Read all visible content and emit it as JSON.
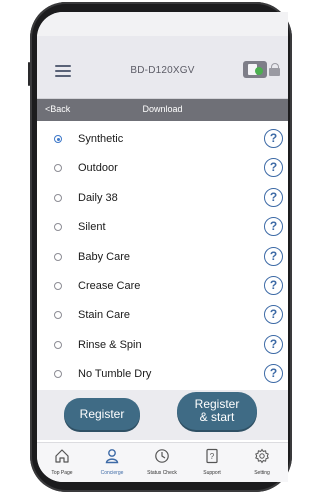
{
  "header": {
    "model": "BD-D120XGV"
  },
  "nav": {
    "back_label": "<Back",
    "title": "Download"
  },
  "programs": [
    {
      "label": "Synthetic",
      "selected": true
    },
    {
      "label": "Outdoor",
      "selected": false
    },
    {
      "label": "Daily 38",
      "selected": false
    },
    {
      "label": "Silent",
      "selected": false
    },
    {
      "label": "Baby Care",
      "selected": false
    },
    {
      "label": "Crease Care",
      "selected": false
    },
    {
      "label": "Stain Care",
      "selected": false
    },
    {
      "label": "Rinse & Spin",
      "selected": false
    },
    {
      "label": "No Tumble Dry",
      "selected": false
    }
  ],
  "help_glyph": "?",
  "actions": {
    "register": "Register",
    "register_start": "Register\n& start"
  },
  "tabs": [
    {
      "label": "Top Page",
      "icon": "home-icon",
      "active": false
    },
    {
      "label": "Concierge",
      "icon": "person-icon",
      "active": true
    },
    {
      "label": "Status Check",
      "icon": "status-icon",
      "active": false
    },
    {
      "label": "Support",
      "icon": "support-icon",
      "active": false
    },
    {
      "label": "Setting",
      "icon": "gear-icon",
      "active": false
    }
  ],
  "colors": {
    "accent": "#3d6aa6",
    "button": "#3f6b85",
    "navbar": "#6f7077"
  }
}
